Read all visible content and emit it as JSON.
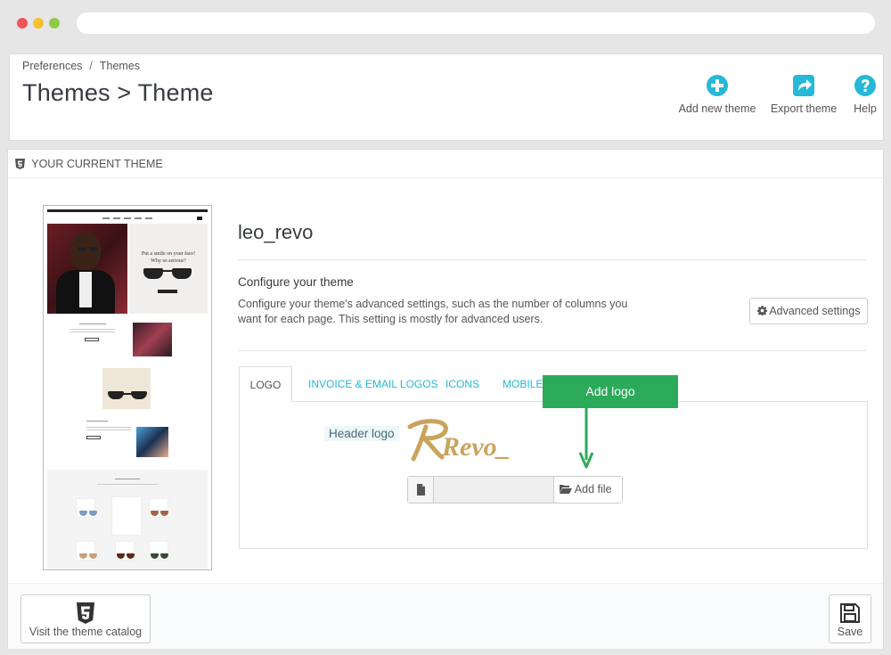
{
  "breadcrumb": {
    "first": "Preferences",
    "separator": "/",
    "second": "Themes"
  },
  "page": {
    "title": "Themes > Theme"
  },
  "toolbar": {
    "add_label": "Add new theme",
    "export_label": "Export theme",
    "help_label": "Help"
  },
  "panel": {
    "heading": "YOUR CURRENT THEME"
  },
  "preview": {
    "hero_line1": "Put a smile on your face!",
    "hero_line2": "Why so serious?"
  },
  "theme": {
    "name": "leo_revo",
    "configure_title": "Configure your theme",
    "configure_desc": "Configure your theme's advanced settings, such as the number of columns you want for each page. This setting is mostly for advanced users.",
    "advanced_label": "Advanced settings"
  },
  "tabs": [
    {
      "label": "LOGO",
      "active": true
    },
    {
      "label": "INVOICE & EMAIL LOGOS",
      "active": false
    },
    {
      "label": "ICONS",
      "active": false
    },
    {
      "label": "MOBILE",
      "active": false
    }
  ],
  "logo_tab": {
    "header_logo_label": "Header logo",
    "logo_text": "Revo_",
    "file_value": "",
    "add_file_label": "Add file"
  },
  "annotation": {
    "label": "Add logo"
  },
  "footer": {
    "catalog_label": "Visit the theme catalog",
    "save_label": "Save"
  },
  "colors": {
    "accent": "#25b9d7",
    "annotation": "#2bab5a",
    "logo_gold": "#c9a45c",
    "title": "#363a41"
  },
  "icons": {
    "add": "plus-circle-icon",
    "export": "share-icon",
    "help": "question-circle-icon",
    "heading": "html5-icon",
    "advanced": "gear-icon",
    "file": "file-icon",
    "add_file": "folder-open-icon",
    "catalog": "html5-icon",
    "save": "floppy-disk-icon"
  }
}
